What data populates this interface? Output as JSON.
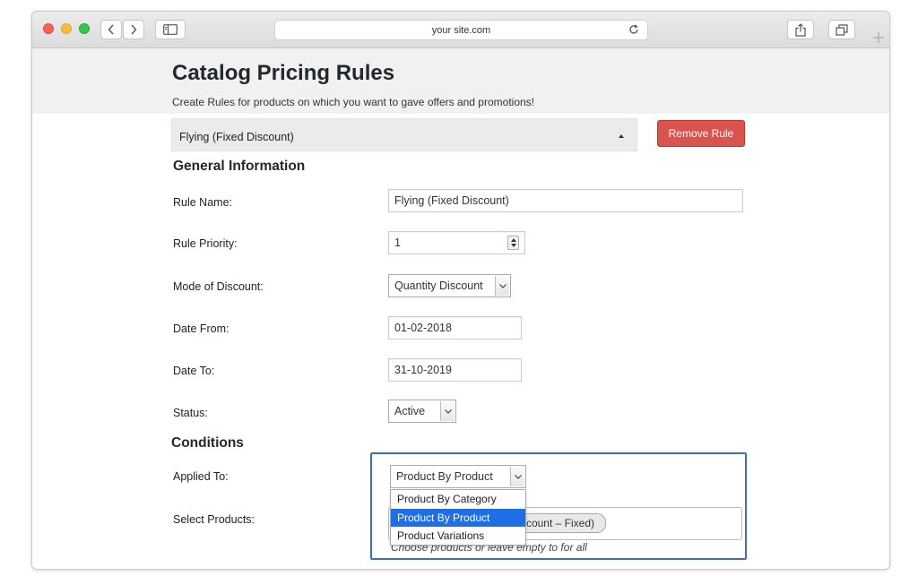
{
  "browser": {
    "url": "your site.com"
  },
  "page": {
    "title": "Catalog Pricing Rules",
    "subtitle": "Create Rules for products on which you want to gave offers and promotions!"
  },
  "rule": {
    "accordion_title": "Flying (Fixed Discount)",
    "remove_label": "Remove Rule"
  },
  "general": {
    "title": "General Information",
    "rule_name_label": "Rule Name:",
    "rule_name_value": "Flying (Fixed Discount)",
    "rule_priority_label": "Rule Priority:",
    "rule_priority_value": "1",
    "mode_label": "Mode of Discount:",
    "mode_value": "Quantity Discount",
    "date_from_label": "Date From:",
    "date_from_value": "01-02-2018",
    "date_to_label": "Date To:",
    "date_to_value": "31-10-2019",
    "status_label": "Status:",
    "status_value": "Active"
  },
  "conditions": {
    "title": "Conditions",
    "applied_to_label": "Applied To:",
    "applied_to_value": "Product By Product",
    "applied_to_options": [
      "Product By Category",
      "Product By Product",
      "Product Variations"
    ],
    "applied_to_selected_index": 1,
    "select_products_label": "Select Products:",
    "selected_product_tag_partial": "iscount – Fixed)",
    "products_hint": "Choose products or leave empty to for all"
  },
  "colors": {
    "remove_button": "#d9534f",
    "highlight_border": "#3e6fb6",
    "selected_option": "#1e6ee6"
  }
}
